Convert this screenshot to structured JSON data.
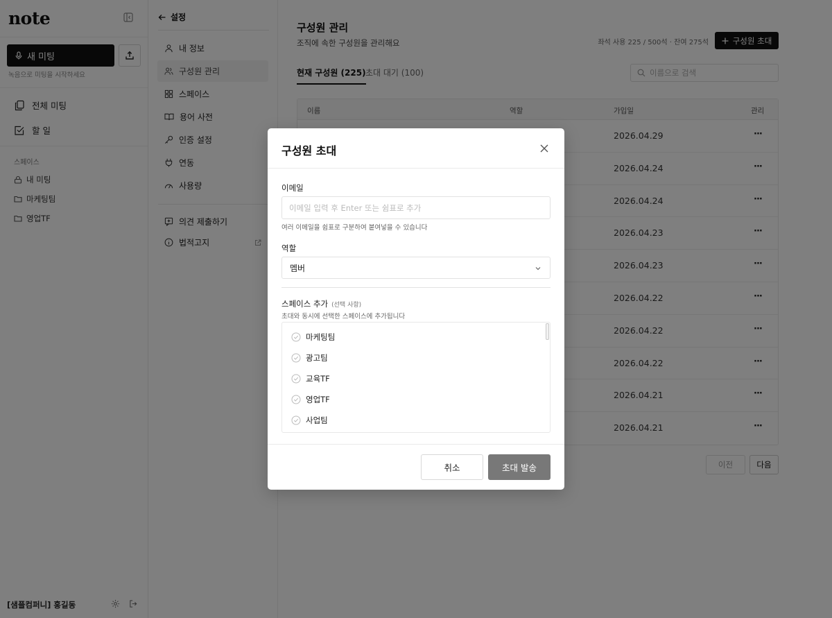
{
  "sidebar": {
    "logo": "note",
    "new_meeting_label": "새 미팅",
    "new_meeting_hint": "녹음으로 미팅을 시작하세요",
    "nav": [
      {
        "label": "전체 미팅",
        "icon": "copy-icon"
      },
      {
        "label": "할 일",
        "icon": "checkbox-icon"
      }
    ],
    "section_label": "스페이스",
    "spaces": [
      {
        "label": "내 미팅",
        "icon": "lock-icon"
      },
      {
        "label": "마케팅팀",
        "icon": "folder-icon"
      },
      {
        "label": "영업TF",
        "icon": "folder-icon"
      }
    ],
    "user_name": "[샘플컴퍼니] 홍길동"
  },
  "settings_nav": {
    "back_label": "설정",
    "items": [
      {
        "label": "내 정보",
        "icon": "user-icon"
      },
      {
        "label": "구성원 관리",
        "icon": "users-icon"
      },
      {
        "label": "스페이스",
        "icon": "grid-icon"
      },
      {
        "label": "용어 사전",
        "icon": "book-icon"
      },
      {
        "label": "인증 설정",
        "icon": "key-icon"
      },
      {
        "label": "연동",
        "icon": "plug-icon"
      },
      {
        "label": "사용량",
        "icon": "gauge-icon"
      }
    ],
    "bottom_items": [
      {
        "label": "의견 제출하기",
        "icon": "feedback-icon"
      },
      {
        "label": "법적고지",
        "icon": "info-icon"
      }
    ]
  },
  "main": {
    "title": "구성원 관리",
    "subtitle": "조직에 속한 구성원을 관리해요",
    "seat_info": "좌석 사용 225 / 500석 · 잔여 275석",
    "invite_button": "구성원 초대",
    "tabs": [
      {
        "label": "현재 구성원 (225)"
      },
      {
        "label": "초대 대기 (100)"
      }
    ],
    "search_placeholder": "이름으로 검색",
    "table": {
      "headers": [
        "이름",
        "역할",
        "가입일",
        "관리"
      ],
      "rows": [
        {
          "joined": "2026.04.29"
        },
        {
          "joined": "2026.04.24"
        },
        {
          "joined": "2026.04.24"
        },
        {
          "joined": "2026.04.23"
        },
        {
          "joined": "2026.04.23"
        },
        {
          "joined": "2026.04.22"
        },
        {
          "joined": "2026.04.22"
        },
        {
          "joined": "2026.04.22"
        },
        {
          "joined": "2026.04.21"
        },
        {
          "joined": "2026.04.21"
        }
      ],
      "more_label": "···"
    },
    "pager": {
      "prev": "이전",
      "next": "다음"
    }
  },
  "modal": {
    "title": "구성원 초대",
    "email_label": "이메일",
    "email_placeholder": "이메일 입력 후 Enter 또는 쉼표로 추가",
    "email_hint": "여러 이메일을 쉼표로 구분하여 붙여넣을 수 있습니다",
    "role_label": "역할",
    "role_value": "멤버",
    "space_label": "스페이스 추가",
    "space_optional": "(선택 사항)",
    "space_hint": "초대와 동시에 선택한 스페이스에 추가됩니다",
    "space_options": [
      {
        "label": "마케팅팀"
      },
      {
        "label": "광고팀"
      },
      {
        "label": "교육TF"
      },
      {
        "label": "영업TF"
      },
      {
        "label": "사업팀"
      }
    ],
    "cancel_label": "취소",
    "submit_label": "초대 발송"
  }
}
